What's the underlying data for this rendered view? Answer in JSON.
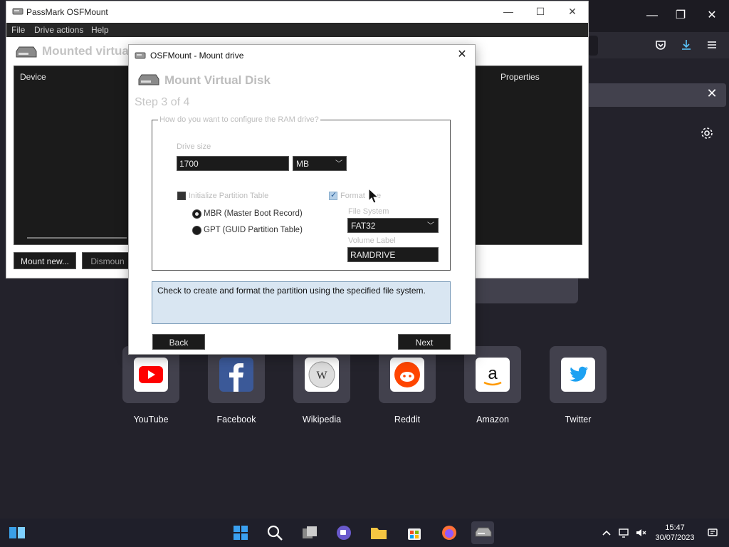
{
  "browser": {
    "minimize_glyph": "—",
    "restore_glyph": "❐",
    "close_glyph": "✕",
    "notification_close_glyph": "✕",
    "shortcuts": [
      {
        "label": "YouTube",
        "icon": "youtube-logo-icon",
        "color": "#ff0000"
      },
      {
        "label": "Facebook",
        "icon": "facebook-logo-icon",
        "color": "#3b5998"
      },
      {
        "label": "Wikipedia",
        "icon": "wikipedia-logo-icon",
        "color": "#777777"
      },
      {
        "label": "Reddit",
        "icon": "reddit-logo-icon",
        "color": "#ff4500"
      },
      {
        "label": "Amazon",
        "icon": "amazon-logo-icon",
        "color": "#ff9900"
      },
      {
        "label": "Twitter",
        "icon": "twitter-logo-icon",
        "color": "#1da1f2"
      }
    ]
  },
  "main_window": {
    "title": "PassMark OSFMount",
    "menu": [
      "File",
      "Drive actions",
      "Help"
    ],
    "heading": "Mounted virtual",
    "columns": {
      "device": "Device",
      "properties": "Properties"
    },
    "buttons": {
      "mount_new": "Mount new...",
      "dismount": "Dismoun"
    }
  },
  "dialog": {
    "title": "OSFMount - Mount drive",
    "heading": "Mount Virtual Disk",
    "step": "Step 3 of 4",
    "group_label": "How do you want to configure the RAM drive?",
    "drive_size_label": "Drive size",
    "drive_size_value": "1700",
    "drive_size_unit": "MB",
    "init_partition_label": "Initialize Partition Table",
    "init_partition_checked": false,
    "mbr_label": "MBR (Master Boot Record)",
    "gpt_label": "GPT (GUID Partition Table)",
    "format_label": "Format",
    "format_label_tail": "e",
    "format_checked": true,
    "file_system_label": "File System",
    "file_system_value": "FAT32",
    "volume_label_label": "Volume Label",
    "volume_label_value": "RAMDRIVE",
    "help_text": "Check to create and format the partition using the specified file system.",
    "back_label": "Back",
    "next_label": "Next"
  },
  "taskbar": {
    "time": "15:47",
    "date": "30/07/2023",
    "apps": [
      "widgets-icon",
      "start-icon",
      "search-icon",
      "task-view-icon",
      "chat-icon",
      "file-explorer-icon",
      "store-icon",
      "firefox-icon",
      "osfmount-icon"
    ]
  },
  "colors": {
    "accent": "#1da1f2",
    "help_bg": "#d9e6f2",
    "dark_control": "#1b1b1b"
  }
}
